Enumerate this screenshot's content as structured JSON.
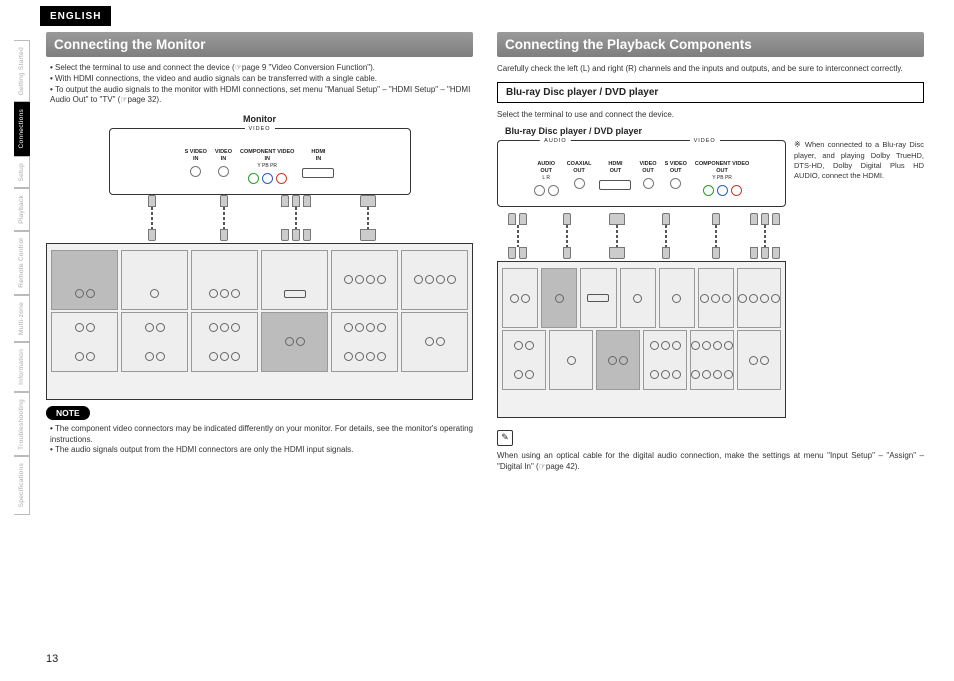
{
  "language_tab": "ENGLISH",
  "page_number": "13",
  "sidenav": [
    {
      "label": "Getting Started",
      "active": false
    },
    {
      "label": "Connections",
      "active": true
    },
    {
      "label": "Setup",
      "active": false
    },
    {
      "label": "Playback",
      "active": false
    },
    {
      "label": "Remote Control",
      "active": false
    },
    {
      "label": "Multi-zone",
      "active": false
    },
    {
      "label": "Information",
      "active": false
    },
    {
      "label": "Troubleshooting",
      "active": false
    },
    {
      "label": "Specifications",
      "active": false
    }
  ],
  "left": {
    "heading": "Connecting the Monitor",
    "bullets": [
      "Select the terminal to use and connect the device (☞page 9 \"Video Conversion Function\").",
      "With HDMI connections, the video and audio signals can be transferred with a single cable.",
      "To output the audio signals to the monitor with HDMI connections, set menu \"Manual Setup\" – \"HDMI Setup\" – \"HDMI Audio Out\" to \"TV\" (☞page 32)."
    ],
    "monitor_label": "Monitor",
    "video_legend": "VIDEO",
    "ports": {
      "svideo": {
        "title": "S VIDEO",
        "sub": "IN"
      },
      "video": {
        "title": "VIDEO",
        "sub": "IN"
      },
      "component": {
        "title": "COMPONENT VIDEO",
        "sub": "IN",
        "chans": "Y   PB   PR"
      },
      "hdmi": {
        "title": "HDMI",
        "sub": "IN"
      }
    },
    "note_label": "NOTE",
    "notes": [
      "The component video connectors may be indicated differently on your monitor. For details, see the monitor's operating instructions.",
      "The audio signals output from the HDMI connectors are only the HDMI input signals."
    ]
  },
  "right": {
    "heading": "Connecting the Playback Components",
    "intro": "Carefully check the left (L) and right (R) channels and the inputs and outputs, and be sure to interconnect correctly.",
    "sub_heading": "Blu-ray Disc player / DVD player",
    "sub_intro": "Select the terminal to use and connect the device.",
    "device_label": "Blu-ray Disc player / DVD player",
    "audio_legend": "AUDIO",
    "video_legend": "VIDEO",
    "ports": {
      "audio": {
        "title": "AUDIO",
        "sub": "OUT",
        "chans": "L   R"
      },
      "coax": {
        "title": "COAXIAL",
        "sub": "OUT"
      },
      "hdmi": {
        "title": "HDMI",
        "sub": "OUT"
      },
      "video": {
        "title": "VIDEO",
        "sub": "OUT"
      },
      "svideo": {
        "title": "S VIDEO",
        "sub": "OUT"
      },
      "component": {
        "title": "COMPONENT VIDEO",
        "sub": "OUT",
        "chans": "Y   PB   PR"
      }
    },
    "side_note_marker": "※",
    "side_note": "When connected to a Blu-ray Disc player, and playing Dolby TrueHD, DTS-HD, Dolby Digital Plus HD AUDIO, connect the HDMI.",
    "pen_icon": "✎",
    "footer": "When using an optical cable for the digital audio connection, make the settings at menu \"Input Setup\" – \"Assign\" – \"Digital In\" (☞page 42)."
  }
}
